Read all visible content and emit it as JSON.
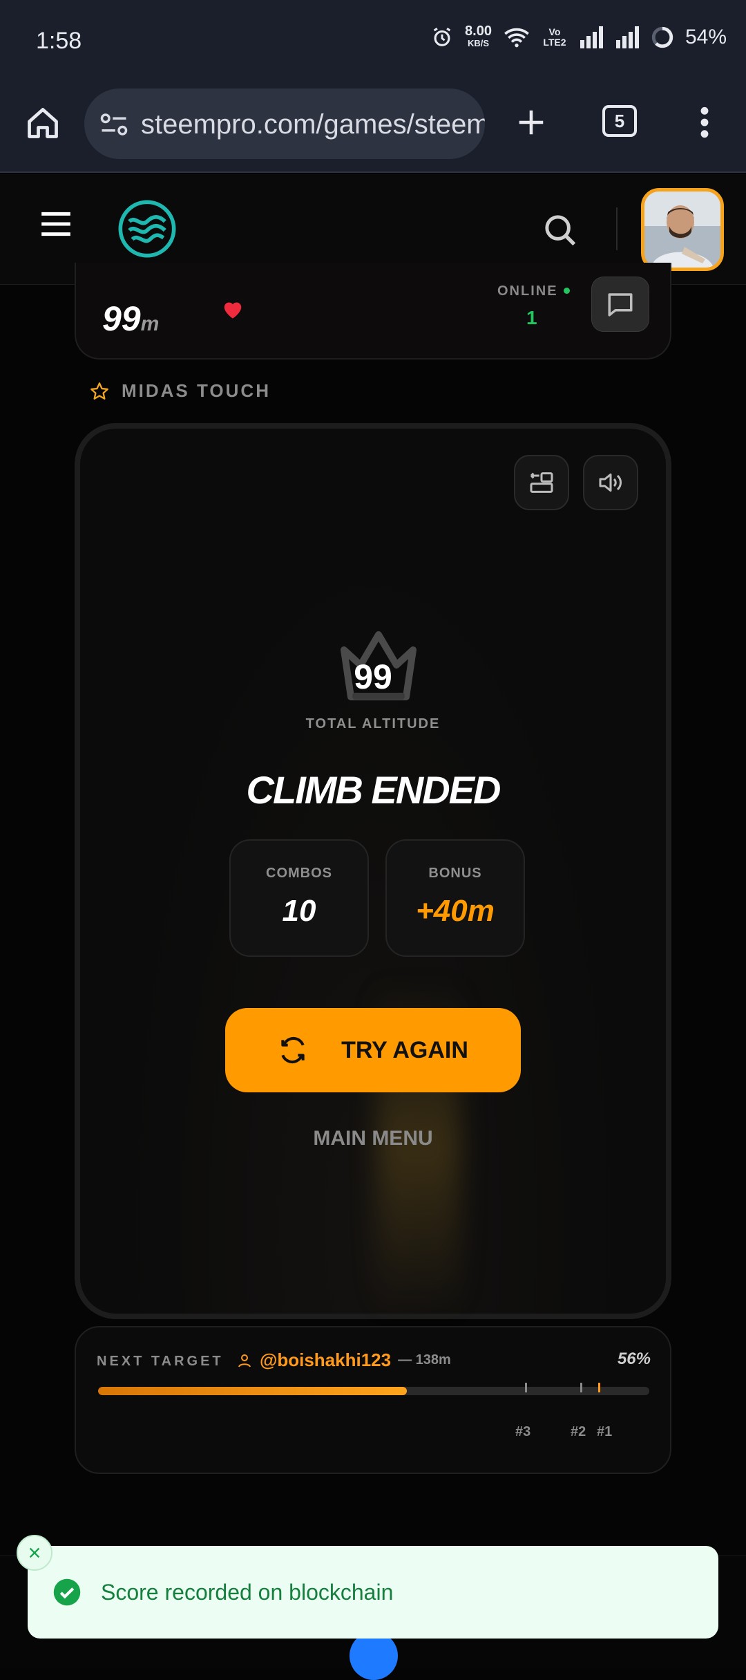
{
  "status_bar": {
    "time": "1:58",
    "net_speed": "8.00",
    "net_unit": "KB/S",
    "volte": "Vo LTE2",
    "battery": "54%"
  },
  "browser": {
    "url": "steempro.com/games/steem",
    "tab_count": "5"
  },
  "header": {
    "logo": "steempro-wave-logo",
    "avatar": "user-avatar"
  },
  "stats_bar": {
    "score": "99",
    "score_unit": "m",
    "online_label": "ONLINE",
    "online_count": "1"
  },
  "game_label": "MIDAS TOUCH",
  "game": {
    "crown_score": "99",
    "total_altitude_label": "TOTAL ALTITUDE",
    "status_title": "CLIMB ENDED",
    "combos_label": "COMBOS",
    "combos_value": "10",
    "bonus_label": "BONUS",
    "bonus_value": "+40m",
    "try_again_label": "TRY AGAIN",
    "main_menu_label": "MAIN MENU"
  },
  "next_target": {
    "label": "NEXT TARGET",
    "user": "@boishakhi123",
    "distance": "— 138m",
    "percent": "56%",
    "progress": 0.56,
    "ranks": [
      "#3",
      "#2",
      "#1"
    ]
  },
  "toast": {
    "message": "Score recorded on blockchain"
  },
  "colors": {
    "accent": "#ff9a00",
    "success": "#15803d",
    "online": "#22c55e"
  }
}
